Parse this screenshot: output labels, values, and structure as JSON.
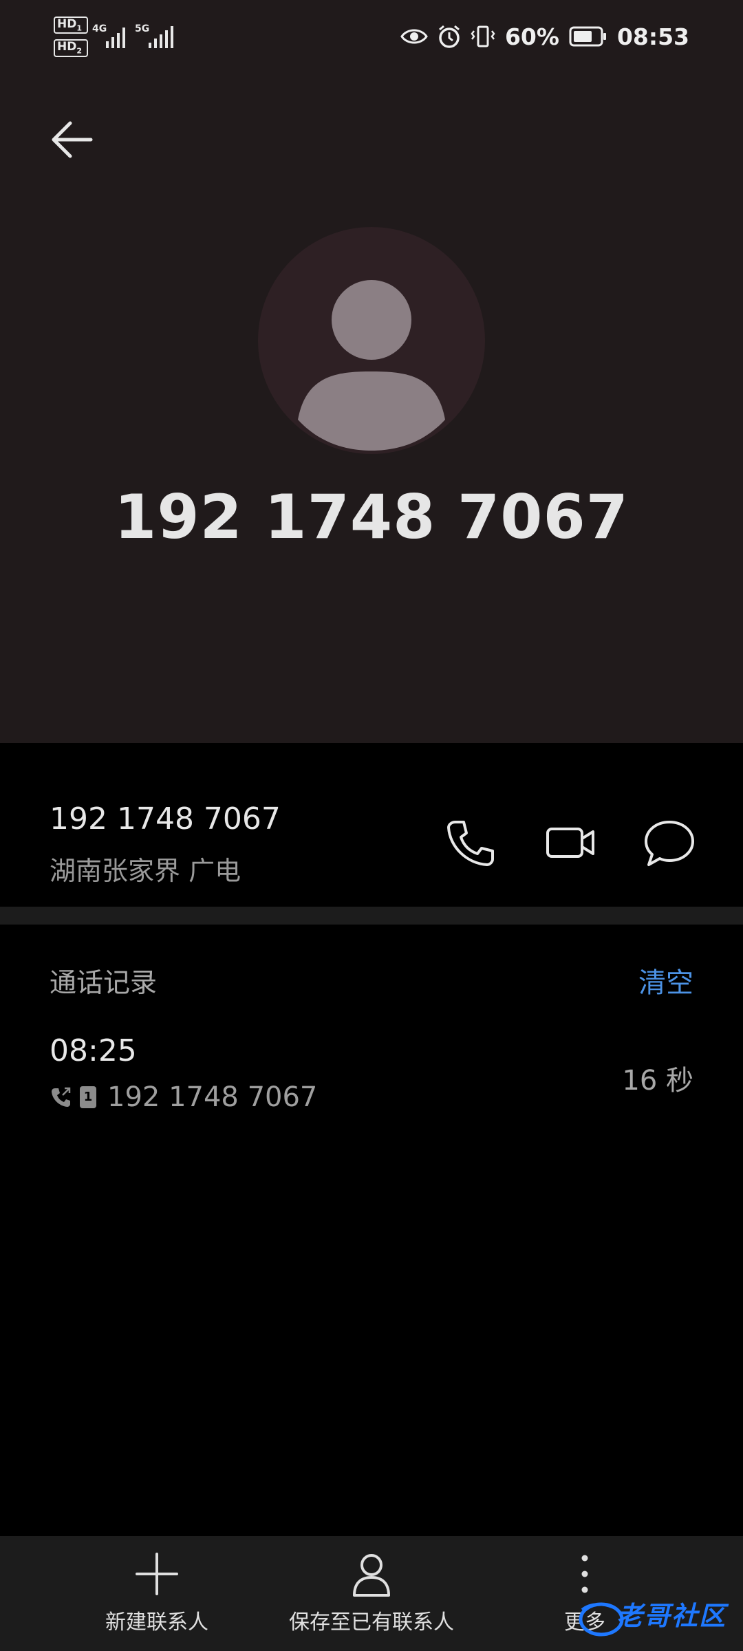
{
  "status_bar": {
    "hd1": "HD",
    "hd1_sub": "1",
    "hd2": "HD",
    "hd2_sub": "2",
    "net1": "4G",
    "net2": "5G",
    "battery": "60%",
    "time": "08:53",
    "icons": [
      "eye-icon",
      "alarm-icon",
      "vibrate-icon",
      "battery-icon"
    ]
  },
  "header": {
    "back_icon": "back-arrow-icon",
    "avatar_icon": "person-icon",
    "number": "192 1748 7067"
  },
  "contact_info": {
    "number": "192 1748 7067",
    "location": "湖南张家界 广电",
    "actions": [
      "phone-icon",
      "video-call-icon",
      "message-icon"
    ]
  },
  "call_log": {
    "title": "通话记录",
    "clear_label": "清空",
    "entries": [
      {
        "time": "08:25",
        "sim": "1",
        "number": "192 1748 7067",
        "duration": "16 秒",
        "type_icon": "outgoing-call-icon"
      }
    ]
  },
  "bottom_bar": {
    "items": [
      {
        "label": "新建联系人",
        "icon": "plus-icon"
      },
      {
        "label": "保存至已有联系人",
        "icon": "person-outline-icon"
      },
      {
        "label": "更多",
        "icon": "more-vert-icon"
      }
    ]
  },
  "watermark": {
    "text": "老哥社区"
  },
  "colors": {
    "hero_bg": "#201a1b",
    "accent": "#4c93e6",
    "page_bg": "#000000",
    "bottom_bg": "#1c1c1c"
  }
}
